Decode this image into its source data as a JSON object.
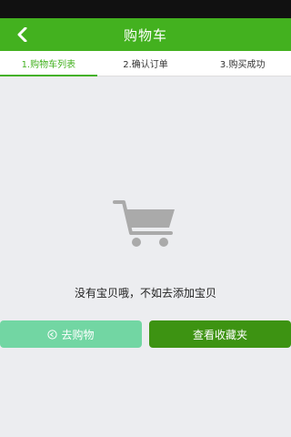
{
  "header": {
    "title": "购物车",
    "back_icon": "chevron-left-icon"
  },
  "steps": [
    {
      "label": "1.购物车列表",
      "active": true
    },
    {
      "label": "2.确认订单",
      "active": false
    },
    {
      "label": "3.购买成功",
      "active": false
    }
  ],
  "empty_state": {
    "icon": "shopping-cart-icon",
    "message": "没有宝贝哦，不如去添加宝贝"
  },
  "buttons": {
    "go_shopping": "去购物",
    "go_shopping_icon": "return-arrow-icon",
    "view_favorites": "查看收藏夹"
  },
  "colors": {
    "accent": "#43b11f",
    "shop_button": "#72d6a3",
    "favorites_button": "#3d9312",
    "background": "#ecedf0"
  }
}
